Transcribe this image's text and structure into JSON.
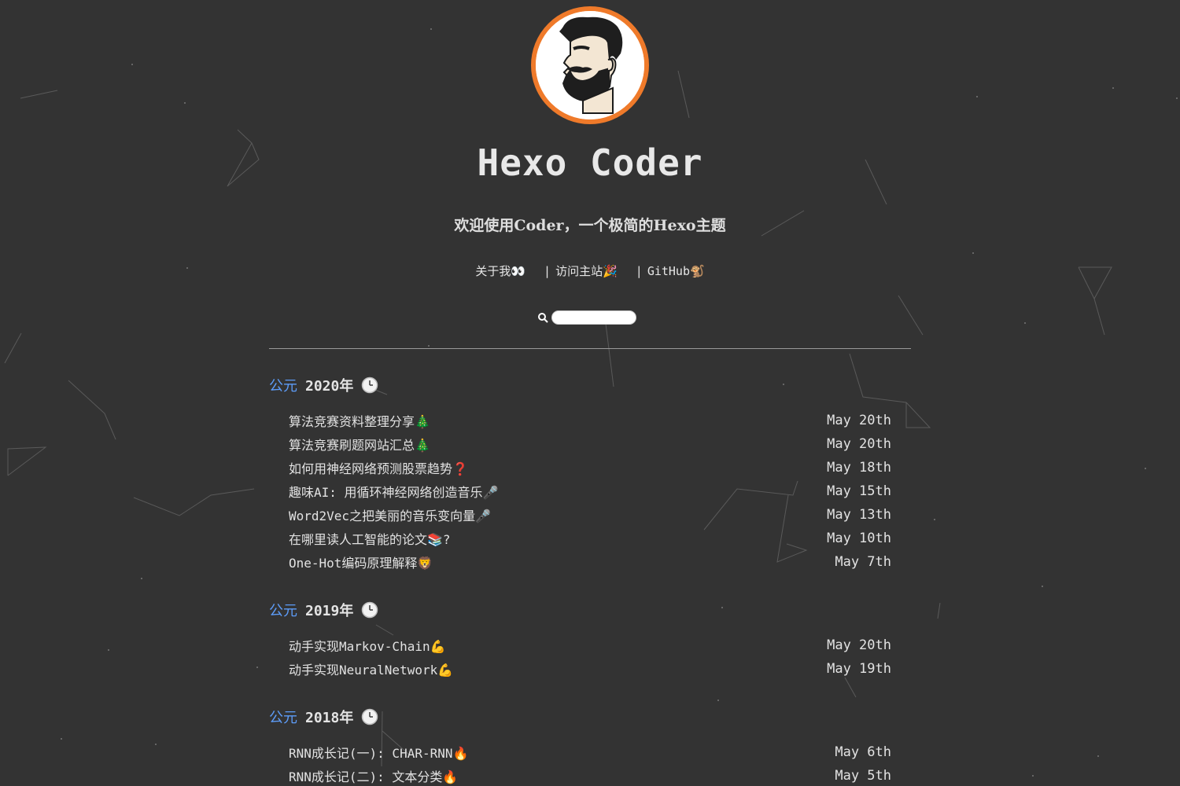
{
  "site": {
    "title": "Hexo Coder",
    "subtitle": "欢迎使用Coder，一个极简的Hexo主题",
    "avatar_icon": "bearded-man-avatar",
    "accent": "#ef7a2a",
    "year_color": "#5d9cf8",
    "background": "#333333"
  },
  "nav": {
    "items": [
      {
        "label": "关于我👀"
      },
      {
        "label": "访问主站🎉"
      },
      {
        "label": "GitHub🐒"
      }
    ],
    "separator": "|"
  },
  "search": {
    "icon": "search-icon",
    "value": "",
    "placeholder": ""
  },
  "archive": [
    {
      "era": "公元",
      "year": "2020年",
      "icon": "clock-icon",
      "posts": [
        {
          "title": "算法竞赛资料整理分享🎄",
          "date": "May 20th"
        },
        {
          "title": "算法竞赛刷题网站汇总🎄",
          "date": "May 20th"
        },
        {
          "title": "如何用神经网络预测股票趋势❓",
          "date": "May 18th"
        },
        {
          "title": "趣味AI: 用循环神经网络创造音乐🎤",
          "date": "May 15th"
        },
        {
          "title": "Word2Vec之把美丽的音乐变向量🎤",
          "date": "May 13th"
        },
        {
          "title": "在哪里读人工智能的论文📚?",
          "date": "May 10th"
        },
        {
          "title": "One-Hot编码原理解释🦁",
          "date": "May 7th"
        }
      ]
    },
    {
      "era": "公元",
      "year": "2019年",
      "icon": "clock-icon",
      "posts": [
        {
          "title": "动手实现Markov-Chain💪",
          "date": "May 20th"
        },
        {
          "title": "动手实现NeuralNetwork💪",
          "date": "May 19th"
        }
      ]
    },
    {
      "era": "公元",
      "year": "2018年",
      "icon": "clock-icon",
      "posts": [
        {
          "title": "RNN成长记(一): CHAR-RNN🔥",
          "date": "May 6th"
        },
        {
          "title": "RNN成长记(二): 文本分类🔥",
          "date": "May 5th"
        }
      ]
    }
  ]
}
